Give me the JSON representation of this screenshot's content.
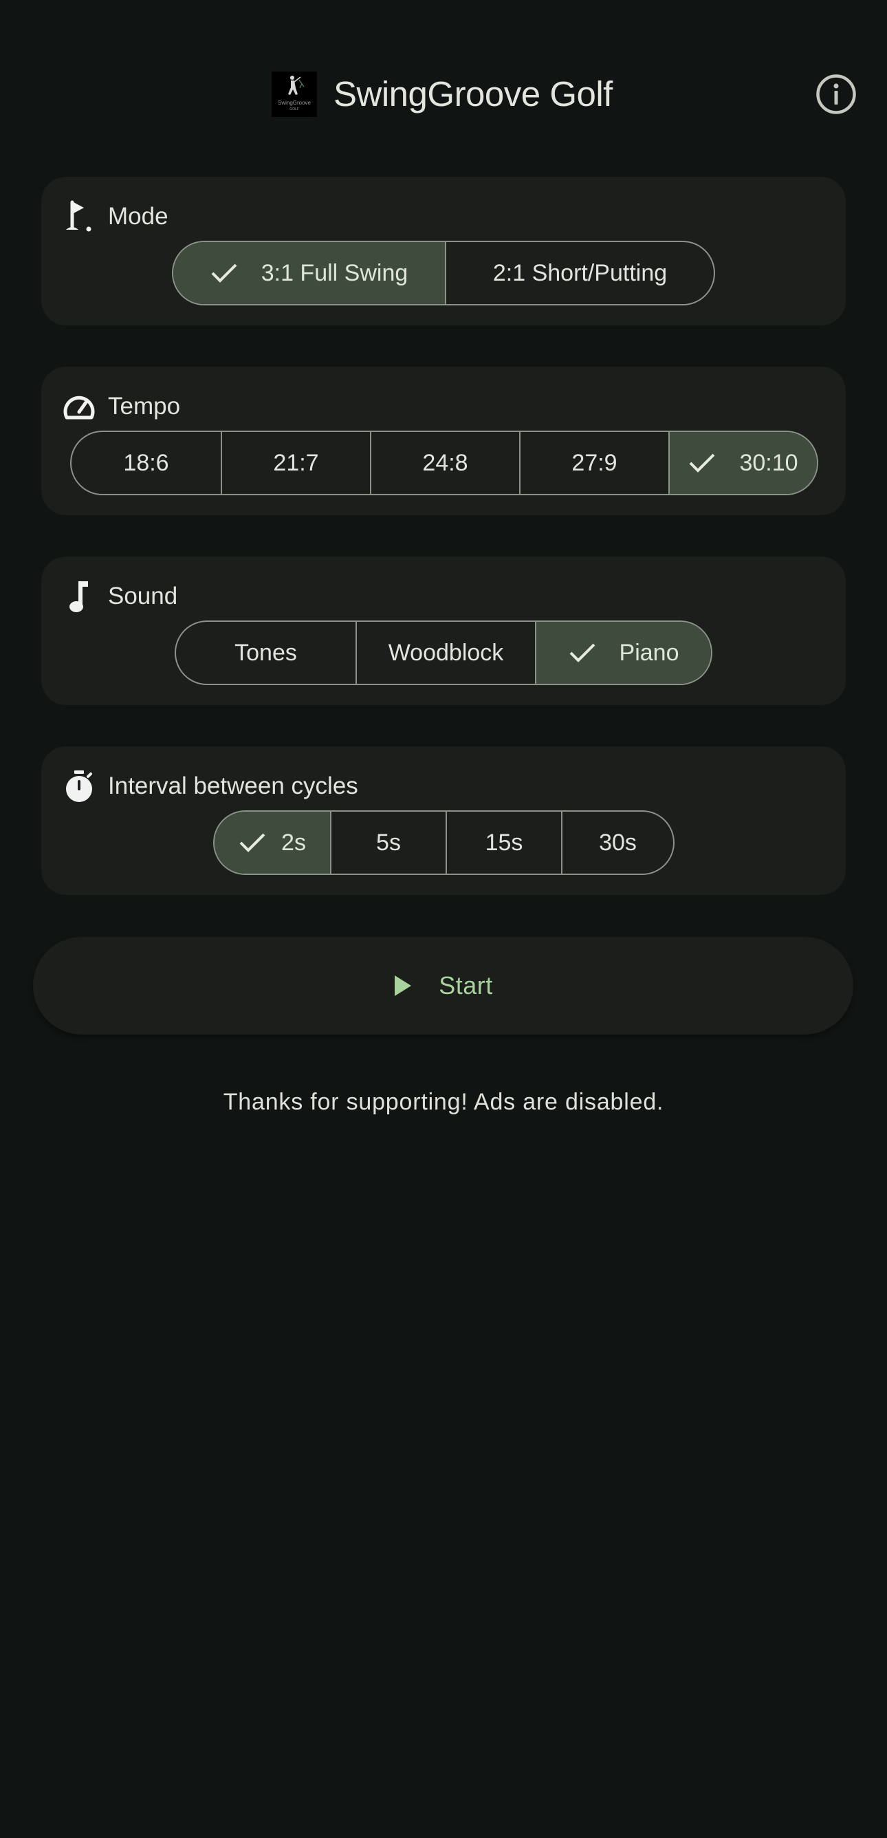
{
  "app": {
    "title": "SwingGroove Golf",
    "logo_text": "SwingGroove GOLF",
    "info_icon": "info-icon"
  },
  "mode": {
    "title": "Mode",
    "icon": "golf-flag-icon",
    "options": [
      "3:1 Full Swing",
      "2:1 Short/Putting"
    ],
    "selected": "3:1 Full Swing"
  },
  "tempo": {
    "title": "Tempo",
    "icon": "speedometer-icon",
    "options": [
      "18:6",
      "21:7",
      "24:8",
      "27:9",
      "30:10"
    ],
    "selected": "30:10"
  },
  "sound": {
    "title": "Sound",
    "icon": "music-note-icon",
    "options": [
      "Tones",
      "Woodblock",
      "Piano"
    ],
    "selected": "Piano"
  },
  "interval": {
    "title": "Interval between cycles",
    "icon": "stopwatch-icon",
    "options": [
      "2s",
      "5s",
      "15s",
      "30s"
    ],
    "selected": "2s"
  },
  "start": {
    "label": "Start",
    "icon": "play-icon"
  },
  "notice": "Thanks for supporting! Ads are disabled.",
  "colors": {
    "background": "#101412",
    "card": "#1c1e1b",
    "selected_segment": "#3f4c3d",
    "accent_green": "#a9d39c",
    "outline": "#8b9388"
  }
}
